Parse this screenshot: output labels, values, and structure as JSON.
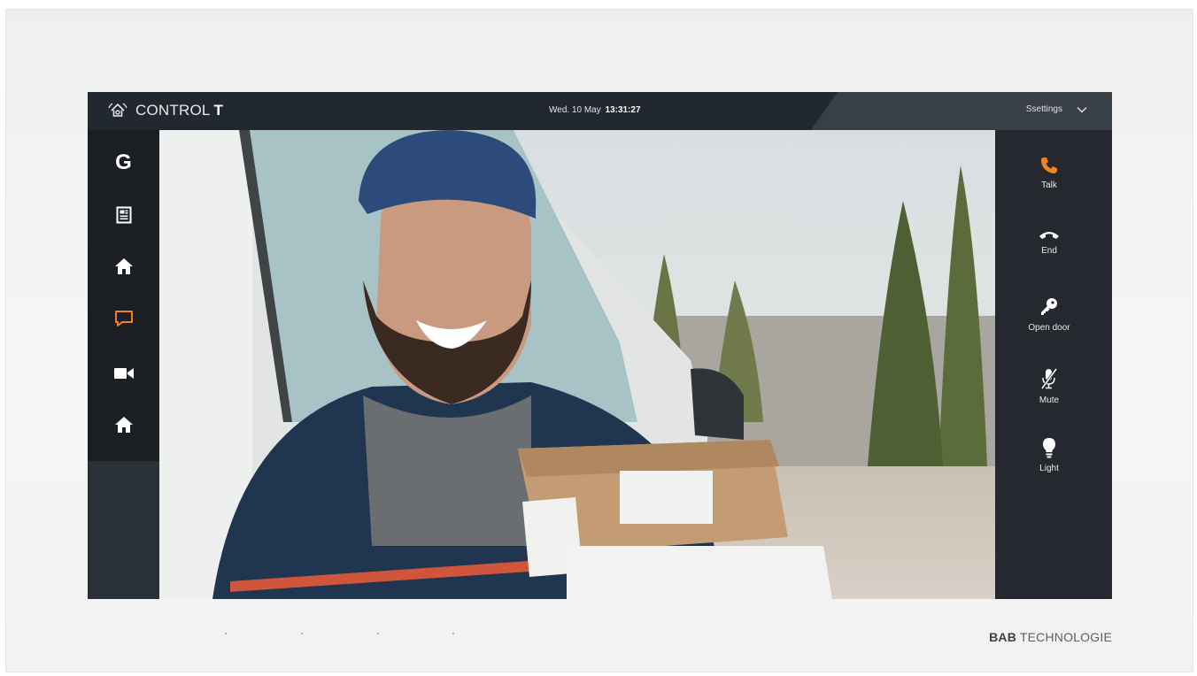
{
  "app": {
    "brand": "CONTROL",
    "brand_suffix": "T",
    "date": "Wed. 10 May",
    "time": "13:31:27",
    "settings_label": "Ssettings"
  },
  "nav": {
    "items": [
      {
        "name": "google",
        "label": "G",
        "icon": "google-icon"
      },
      {
        "name": "news",
        "icon": "newspaper-icon"
      },
      {
        "name": "home",
        "icon": "home-icon"
      },
      {
        "name": "intercom",
        "icon": "chat-icon",
        "active": true
      },
      {
        "name": "camera",
        "icon": "video-camera-icon"
      },
      {
        "name": "home-2",
        "icon": "home-icon"
      }
    ]
  },
  "actions": [
    {
      "label": "Talk",
      "icon": "phone-icon",
      "color": "#f5821f"
    },
    {
      "label": "End",
      "icon": "hangup-icon"
    },
    {
      "label": "Open door",
      "icon": "key-icon"
    },
    {
      "label": "Mute",
      "icon": "mic-muted-icon"
    },
    {
      "label": "Light",
      "icon": "lightbulb-icon"
    }
  ],
  "footer": {
    "maker_bold": "BAB",
    "maker_rest": "TECHNOLOGIE"
  },
  "colors": {
    "accent": "#f5821f",
    "screen_bg": "#24292e",
    "sidebar_bg": "#1b1f24"
  }
}
